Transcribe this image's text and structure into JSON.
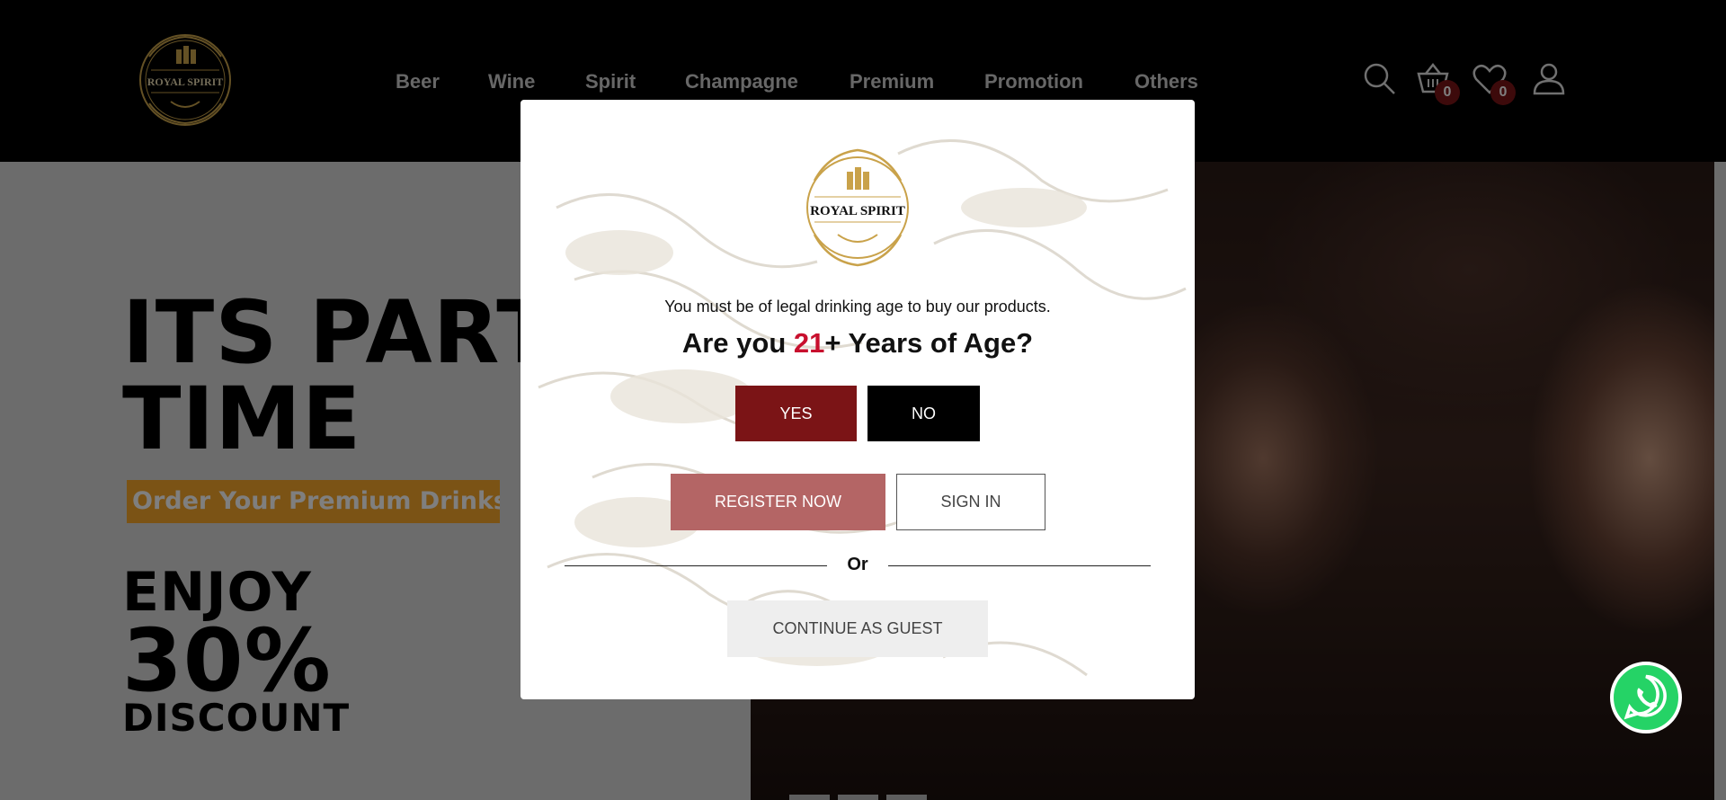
{
  "brand": {
    "name": "ROYAL SPIRIT"
  },
  "nav": {
    "items": [
      "Beer",
      "Wine",
      "Spirit",
      "Champagne",
      "Premium",
      "Promotion",
      "Others"
    ]
  },
  "header_icons": {
    "search": "search-icon",
    "cart": "cart-icon",
    "wishlist": "heart-icon",
    "account": "user-icon",
    "cart_count": "0",
    "wishlist_count": "0"
  },
  "hero": {
    "line1": "ITS PARTY",
    "line2": "TIME",
    "tag": "Order Your Premium Drinks",
    "enjoy": "ENJOY",
    "percent": "30%",
    "discount": "DISCOUNT"
  },
  "modal": {
    "logo_text": "ROYAL SPIRIT",
    "note": "You must be of legal drinking age to buy our products.",
    "question_pre": "Are you ",
    "question_num": "21",
    "question_post": "+ Years of Age?",
    "yes_label": "YES",
    "no_label": "NO",
    "register_label": "REGISTER NOW",
    "signin_label": "SIGN IN",
    "or_label": "Or",
    "guest_label": "CONTINUE AS GUEST"
  },
  "colors": {
    "accent": "#7b1416",
    "age_number": "#c8102e",
    "promo_tag": "#f7a62b",
    "whatsapp": "#25d366"
  }
}
